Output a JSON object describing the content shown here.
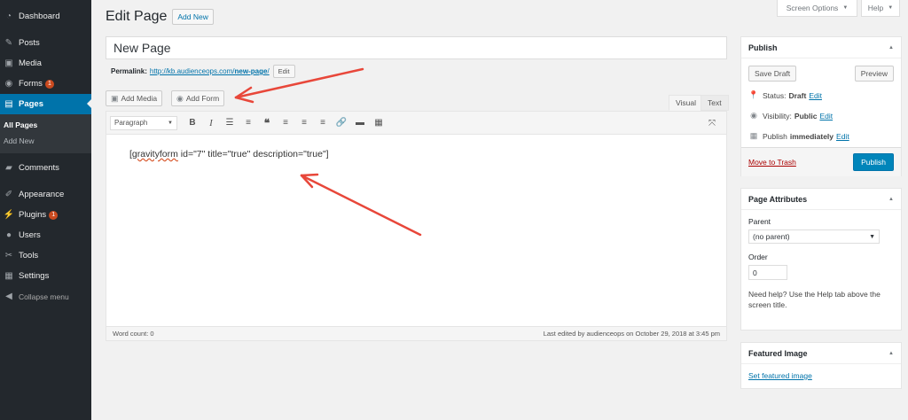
{
  "sidebar": {
    "items": [
      {
        "label": "Dashboard",
        "icon": "dashboard-icon",
        "glyph": "◔"
      },
      {
        "label": "Posts",
        "icon": "pin-icon",
        "glyph": "✎"
      },
      {
        "label": "Media",
        "icon": "media-icon",
        "glyph": "▣"
      },
      {
        "label": "Forms",
        "icon": "forms-icon",
        "glyph": "◉",
        "badge": "1"
      },
      {
        "label": "Pages",
        "icon": "pages-icon",
        "glyph": "▤"
      },
      {
        "label": "Comments",
        "icon": "comments-icon",
        "glyph": "▰"
      },
      {
        "label": "Appearance",
        "icon": "appearance-icon",
        "glyph": "✐"
      },
      {
        "label": "Plugins",
        "icon": "plugins-icon",
        "glyph": "⚡",
        "badge": "1"
      },
      {
        "label": "Users",
        "icon": "users-icon",
        "glyph": "●"
      },
      {
        "label": "Tools",
        "icon": "tools-icon",
        "glyph": "✂"
      },
      {
        "label": "Settings",
        "icon": "settings-icon",
        "glyph": "▦"
      }
    ],
    "submenu": [
      "All Pages",
      "Add New"
    ],
    "collapse_label": "Collapse menu"
  },
  "top": {
    "screen_options": "Screen Options",
    "help": "Help"
  },
  "header": {
    "title": "Edit Page",
    "add_new": "Add New"
  },
  "post": {
    "title": "New Page",
    "permalink_label": "Permalink:",
    "permalink_base": "http://kb.audienceops.com/",
    "permalink_slug": "new-page",
    "permalink_end": "/",
    "edit_label": "Edit"
  },
  "editor": {
    "add_media": "Add Media",
    "add_form": "Add Form",
    "tab_visual": "Visual",
    "tab_text": "Text",
    "format_value": "Paragraph",
    "content_word": "gravityform",
    "content_rest": " id=\"7\" title=\"true\" description=\"true\"]",
    "content_bracket": "[",
    "word_count": "Word count: 0",
    "last_edited": "Last edited by audienceops on October 29, 2018 at 3:45 pm"
  },
  "publish": {
    "title": "Publish",
    "save_draft": "Save Draft",
    "preview": "Preview",
    "status_label": "Status:",
    "status_value": "Draft",
    "visibility_label": "Visibility:",
    "visibility_value": "Public",
    "publish_label": "Publish",
    "publish_value": "immediately",
    "edit_link": "Edit",
    "trash": "Move to Trash",
    "publish_button": "Publish"
  },
  "page_attributes": {
    "title": "Page Attributes",
    "parent_label": "Parent",
    "parent_value": "(no parent)",
    "order_label": "Order",
    "order_value": "0",
    "help_text": "Need help? Use the Help tab above the screen title."
  },
  "featured_image": {
    "title": "Featured Image",
    "link": "Set featured image"
  },
  "colors": {
    "sidebar_bg": "#23282d",
    "accent": "#0073aa",
    "primary_button": "#0085ba",
    "badge": "#ca4a1f",
    "annotation_arrow": "#e8473a",
    "trash_link": "#aa0000"
  }
}
